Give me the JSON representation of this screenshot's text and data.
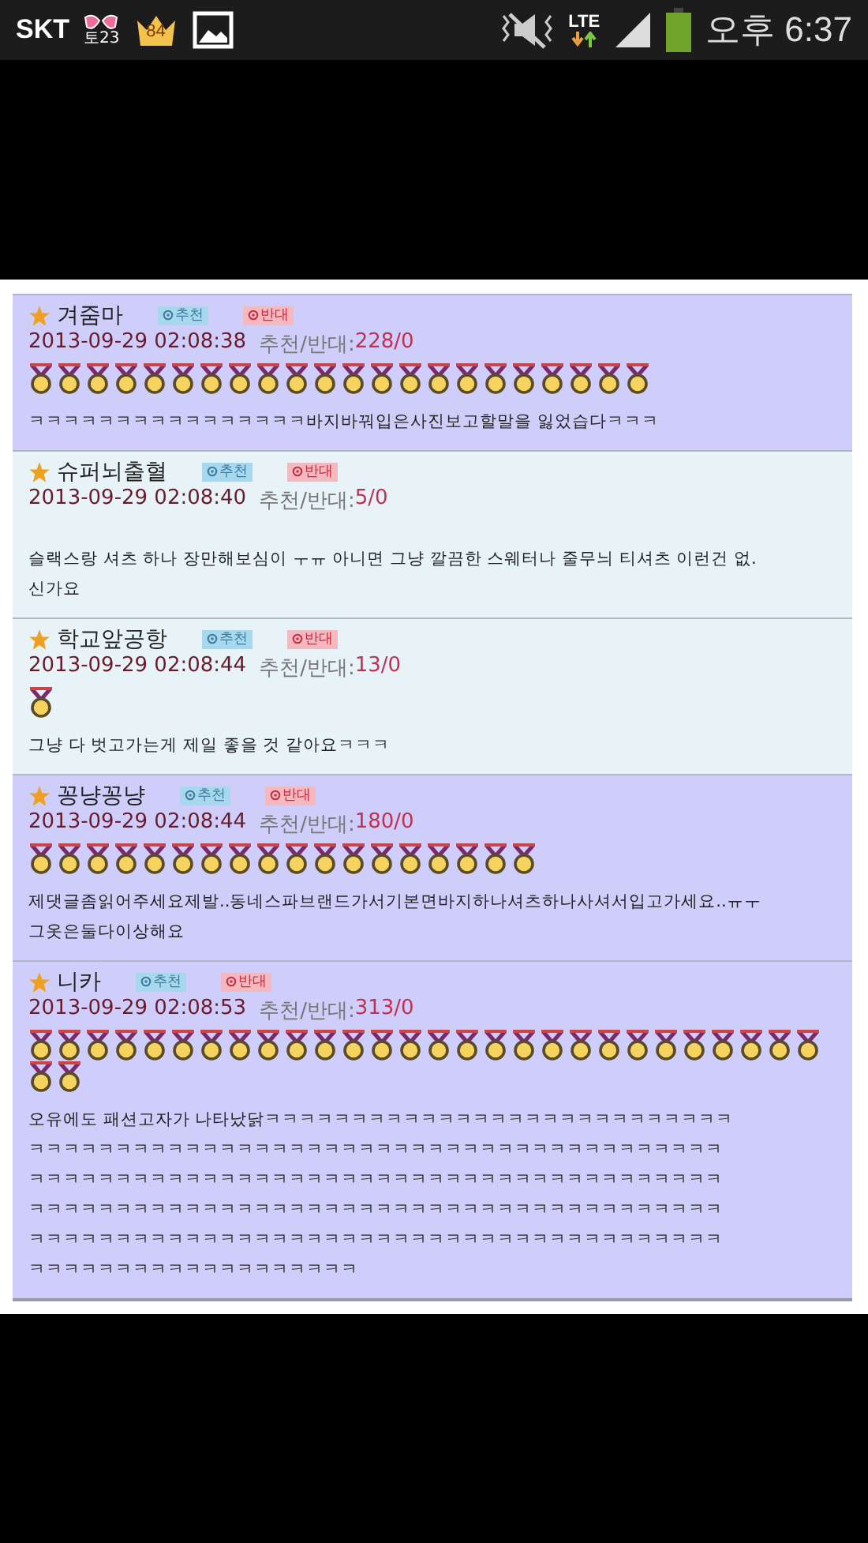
{
  "status_bar": {
    "carrier": "SKT",
    "date_badge": "토23",
    "crown_badge": "84",
    "network": "LTE",
    "time": "오후 6:37"
  },
  "comments": [
    {
      "name": "겨줌마",
      "up_label": "추천",
      "down_label": "반대",
      "date": "2013-09-29 02:08:38",
      "votes_label": "추천/반대:",
      "votes": "228/0",
      "highlighted": true,
      "medals": [
        {
          "kind": "medal"
        },
        {
          "kind": "medal"
        },
        {
          "kind": "medal"
        },
        {
          "kind": "medal"
        },
        {
          "kind": "medal"
        },
        {
          "kind": "medal"
        },
        {
          "kind": "medal"
        },
        {
          "kind": "medal"
        },
        {
          "kind": "medal"
        },
        {
          "kind": "medal"
        },
        {
          "kind": "medal"
        },
        {
          "kind": "medal"
        },
        {
          "kind": "medal"
        },
        {
          "kind": "medal"
        },
        {
          "kind": "medal"
        },
        {
          "kind": "medal"
        },
        {
          "kind": "medal"
        },
        {
          "kind": "medal"
        },
        {
          "kind": "medal"
        },
        {
          "kind": "medal"
        },
        {
          "kind": "medal"
        },
        {
          "kind": "medal"
        }
      ],
      "lines": [
        "ㅋㅋㅋㅋㅋㅋㅋㅋㅋㅋㅋㅋㅋㅋㅋㅋ바지바꿔입은사진보고할말을 잃었습다ㅋㅋㅋ"
      ]
    },
    {
      "name": "슈퍼뇌출혈",
      "up_label": "추천",
      "down_label": "반대",
      "date": "2013-09-29 02:08:40",
      "votes_label": "추천/반대:",
      "votes": "5/0",
      "highlighted": false,
      "lines": [
        "슬랙스랑 셔츠 하나 장만해보심이 ㅜㅠ 아니면 그냥 깔끔한 스웨터나 줄무늬 티셔츠 이런건 없.",
        "신가요"
      ]
    },
    {
      "name": "학교앞공항",
      "up_label": "추천",
      "down_label": "반대",
      "date": "2013-09-29 02:08:44",
      "votes_label": "추천/반대:",
      "votes": "13/0",
      "highlighted": false,
      "medals": [
        {
          "kind": "medal"
        }
      ],
      "lines": [
        "그냥 다 벗고가는게 제일 좋을 것 같아요ㅋㅋㅋ"
      ]
    },
    {
      "name": "꽁냥꽁냥",
      "up_label": "추천",
      "down_label": "반대",
      "date": "2013-09-29 02:08:44",
      "votes_label": "추천/반대:",
      "votes": "180/0",
      "highlighted": true,
      "medals": [
        {
          "kind": "medal"
        },
        {
          "kind": "medal"
        },
        {
          "kind": "medal"
        },
        {
          "kind": "medal"
        },
        {
          "kind": "medal"
        },
        {
          "kind": "medal"
        },
        {
          "kind": "medal"
        },
        {
          "kind": "medal"
        },
        {
          "kind": "medal"
        },
        {
          "kind": "medal"
        },
        {
          "kind": "medal"
        },
        {
          "kind": "medal"
        },
        {
          "kind": "medal"
        },
        {
          "kind": "medal"
        },
        {
          "kind": "medal"
        },
        {
          "kind": "medal"
        },
        {
          "kind": "medal"
        },
        {
          "kind": "medal"
        }
      ],
      "lines": [
        "제댓글좀읽어주세요제발..동네스파브랜드가서기본면바지하나셔츠하나사셔서입고가세요..ㅠㅜ",
        "그옷은둘다이상해요"
      ]
    },
    {
      "name": "니카",
      "up_label": "추천",
      "down_label": "반대",
      "date": "2013-09-29 02:08:53",
      "votes_label": "추천/반대:",
      "votes": "313/0",
      "highlighted": true,
      "medals": [
        {
          "kind": "medal"
        },
        {
          "kind": "medal"
        },
        {
          "kind": "medal"
        },
        {
          "kind": "medal"
        },
        {
          "kind": "medal"
        },
        {
          "kind": "medal"
        },
        {
          "kind": "medal"
        },
        {
          "kind": "medal"
        },
        {
          "kind": "medal"
        },
        {
          "kind": "medal"
        },
        {
          "kind": "medal"
        },
        {
          "kind": "medal"
        },
        {
          "kind": "medal"
        },
        {
          "kind": "medal"
        },
        {
          "kind": "medal"
        },
        {
          "kind": "medal"
        },
        {
          "kind": "medal"
        },
        {
          "kind": "medal"
        },
        {
          "kind": "medal"
        },
        {
          "kind": "medal"
        },
        {
          "kind": "medal"
        },
        {
          "kind": "medal"
        },
        {
          "kind": "medal"
        },
        {
          "kind": "medal"
        },
        {
          "kind": "medal"
        },
        {
          "kind": "medal"
        },
        {
          "kind": "medal"
        },
        {
          "kind": "medal"
        },
        {
          "kind": "medal"
        },
        {
          "kind": "medal"
        }
      ],
      "lines": [
        "오유에도 패션고자가 나타났닭ㅋㅋㅋㅋㅋㅋㅋㅋㅋㅋㅋㅋㅋㅋㅋㅋㅋㅋㅋㅋㅋㅋㅋㅋㅋㅋㅋ",
        "ㅋㅋㅋㅋㅋㅋㅋㅋㅋㅋㅋㅋㅋㅋㅋㅋㅋㅋㅋㅋㅋㅋㅋㅋㅋㅋㅋㅋㅋㅋㅋㅋㅋㅋㅋㅋㅋㅋㅋㅋ",
        "ㅋㅋㅋㅋㅋㅋㅋㅋㅋㅋㅋㅋㅋㅋㅋㅋㅋㅋㅋㅋㅋㅋㅋㅋㅋㅋㅋㅋㅋㅋㅋㅋㅋㅋㅋㅋㅋㅋㅋㅋ",
        "ㅋㅋㅋㅋㅋㅋㅋㅋㅋㅋㅋㅋㅋㅋㅋㅋㅋㅋㅋㅋㅋㅋㅋㅋㅋㅋㅋㅋㅋㅋㅋㅋㅋㅋㅋㅋㅋㅋㅋㅋ",
        "ㅋㅋㅋㅋㅋㅋㅋㅋㅋㅋㅋㅋㅋㅋㅋㅋㅋㅋㅋㅋㅋㅋㅋㅋㅋㅋㅋㅋㅋㅋㅋㅋㅋㅋㅋㅋㅋㅋㅋㅋ",
        "ㅋㅋㅋㅋㅋㅋㅋㅋㅋㅋㅋㅋㅋㅋㅋㅋㅋㅋㅋ"
      ]
    }
  ]
}
